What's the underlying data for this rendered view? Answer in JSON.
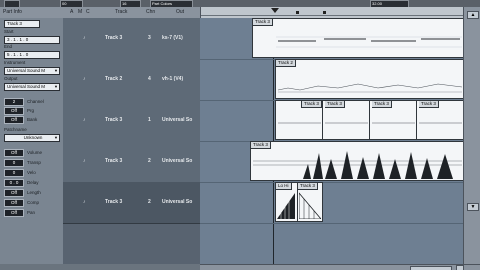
{
  "header": {
    "part_info": "Part Info",
    "col_a": "A",
    "col_m": "M",
    "col_c": "C",
    "col_track": "Track",
    "col_chn": "Chn",
    "col_out": "Out"
  },
  "topbar": {
    "field1": "00",
    "field2": "16",
    "field3": "Part Colors",
    "field4": "32.00"
  },
  "inspector": {
    "track_name": "Track 3",
    "start_label": "Start",
    "start_value": "3 . 1 . 1 . 0",
    "end_label": "End",
    "end_value": "5 . 1 . 1 . 0",
    "instrument_label": "Instrument",
    "instrument_value": "Universal Sound M",
    "output_label": "Output",
    "output_value": "Universal Sound M",
    "params": [
      {
        "value": "2",
        "label": "Channel"
      },
      {
        "value": "Off",
        "label": "Prg"
      },
      {
        "value": "Off",
        "label": "Bank"
      }
    ],
    "patchname_label": "Patchname",
    "patchname_value": "Unknown",
    "params2": [
      {
        "value": "Off",
        "label": "Volume"
      },
      {
        "value": "0",
        "label": "Transp"
      },
      {
        "value": "0",
        "label": "Velo"
      },
      {
        "value": "0 . 0",
        "label": "Delay"
      },
      {
        "value": "Off",
        "label": "Length"
      },
      {
        "value": "Off",
        "label": "Comp"
      },
      {
        "value": "Off",
        "label": "Pan"
      }
    ]
  },
  "tracks": [
    {
      "check": "♪",
      "name": "Track 3",
      "chn": "3",
      "out": "ks-7 (V1)"
    },
    {
      "check": "♪",
      "name": "Track 2",
      "chn": "4",
      "out": "vh-1 (V4)"
    },
    {
      "check": "♪",
      "name": "Track 3",
      "chn": "1",
      "out": "Universal So"
    },
    {
      "check": "♪",
      "name": "Track 3",
      "chn": "2",
      "out": "Universal So"
    },
    {
      "check": "♪",
      "name": "Track 3",
      "chn": "2",
      "out": "Universal So"
    }
  ],
  "arrange": {
    "lane1_part": "Track 3",
    "lane2_part": "Track 2",
    "lane3_parts": [
      "Track 3",
      "Track 3",
      "Track 3",
      "Track 3"
    ],
    "lane4_part": "Track 3",
    "lane5_part_a": "Lo Hi",
    "lane5_part_b": "Track 3"
  }
}
